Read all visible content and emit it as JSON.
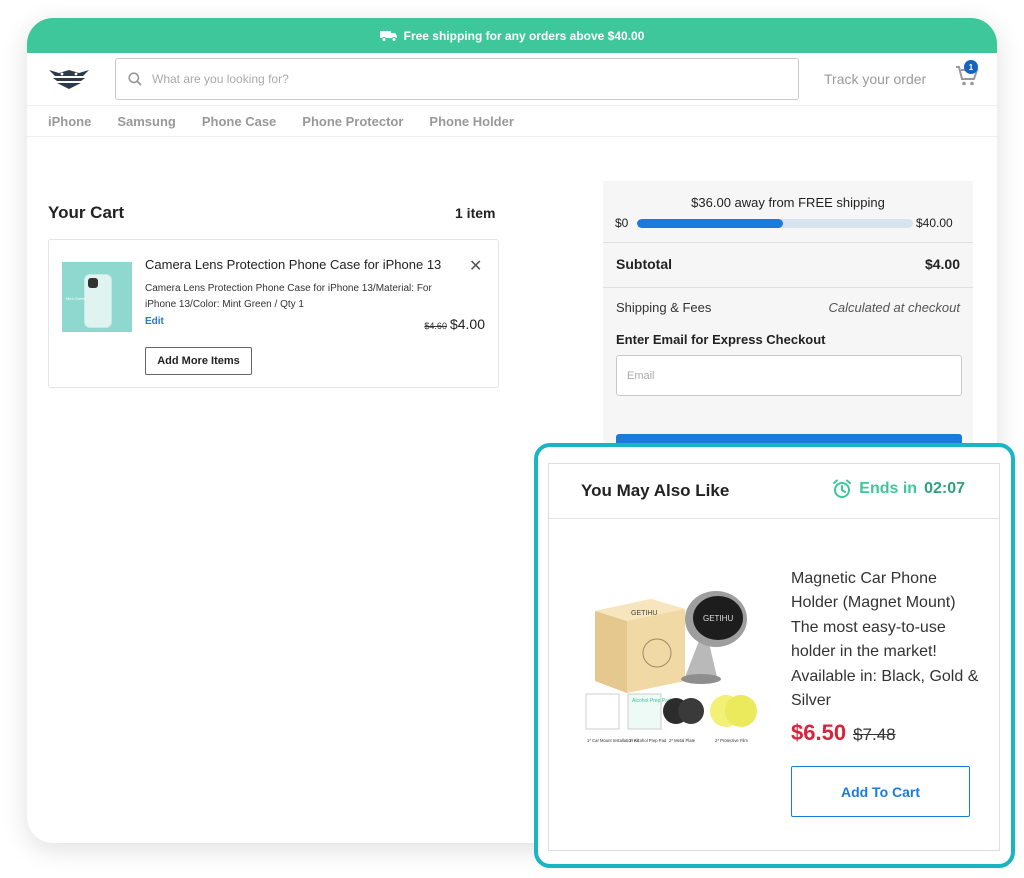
{
  "promo": {
    "text": "Free shipping for any orders above $40.00",
    "icon": "truck-icon"
  },
  "header": {
    "search_placeholder": "What are you looking for?",
    "track_order": "Track your order",
    "cart_badge": "1"
  },
  "nav": {
    "items": [
      "iPhone",
      "Samsung",
      "Phone Case",
      "Phone Protector",
      "Phone Holder"
    ]
  },
  "cart": {
    "title": "Your Cart",
    "count": "1 item",
    "item": {
      "name": "Camera Lens Protection Phone Case for iPhone 13",
      "description": "Camera Lens Protection Phone Case for iPhone 13/Material: For iPhone 13/Color: Mint Green / Qty 1",
      "edit": "Edit",
      "old_price": "$4.60",
      "price": "$4.00",
      "thumb_text": "Mint Green"
    },
    "add_more": "Add More Items"
  },
  "summary": {
    "shipping_message": "$36.00 away from FREE shipping",
    "progress_min": "$0",
    "progress_max": "$40.00",
    "progress_fraction": 0.53,
    "subtotal_label": "Subtotal",
    "subtotal_value": "$4.00",
    "shipping_label": "Shipping & Fees",
    "shipping_value": "Calculated at checkout",
    "email_label": "Enter Email for Express Checkout",
    "email_placeholder": "Email"
  },
  "recommendation": {
    "title": "You May Also Like",
    "ends_label": "Ends in",
    "ends_time": "02:07",
    "product_name": "Magnetic Car Phone Holder (Magnet Mount) The most easy-to-use holder in the market! Available in: Black, Gold & Silver",
    "price": "$6.50",
    "old_price": "$7.48",
    "add_to_cart": "Add To Cart",
    "image_labels": {
      "brand": "GETIHU",
      "kit": "1* Car Mount Installation Kit",
      "pad": "1* Alcohol Prep Pad",
      "plate": "2* Metal Plate",
      "film": "2* Protective Film",
      "pad_title": "Alcohol Prep Pad"
    }
  },
  "colors": {
    "promo_green": "#3ec79a",
    "accent_blue": "#1a7bdc",
    "highlight_teal": "#19b5c3",
    "sale_red": "#d8243a"
  }
}
